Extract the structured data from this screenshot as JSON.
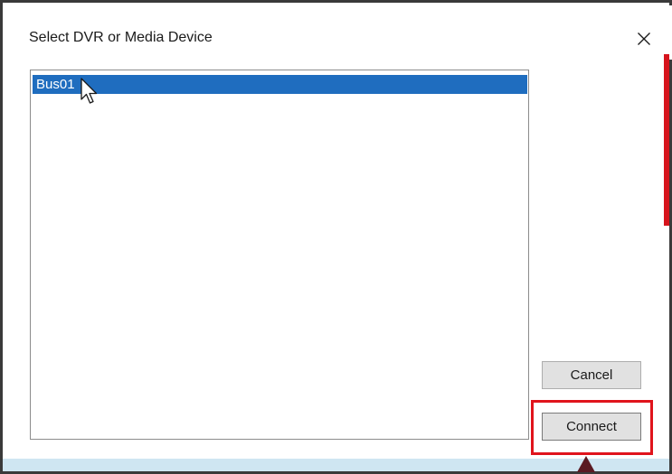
{
  "dialog": {
    "title": "Select DVR or Media Device",
    "close_icon": "close-icon"
  },
  "device_list": {
    "items": [
      {
        "label": "Bus01",
        "selected": true
      }
    ]
  },
  "buttons": {
    "cancel_label": "Cancel",
    "connect_label": "Connect"
  },
  "colors": {
    "selection": "#1f6dbf",
    "highlight_box": "#e0141c",
    "button_bg": "#e1e1e1"
  }
}
